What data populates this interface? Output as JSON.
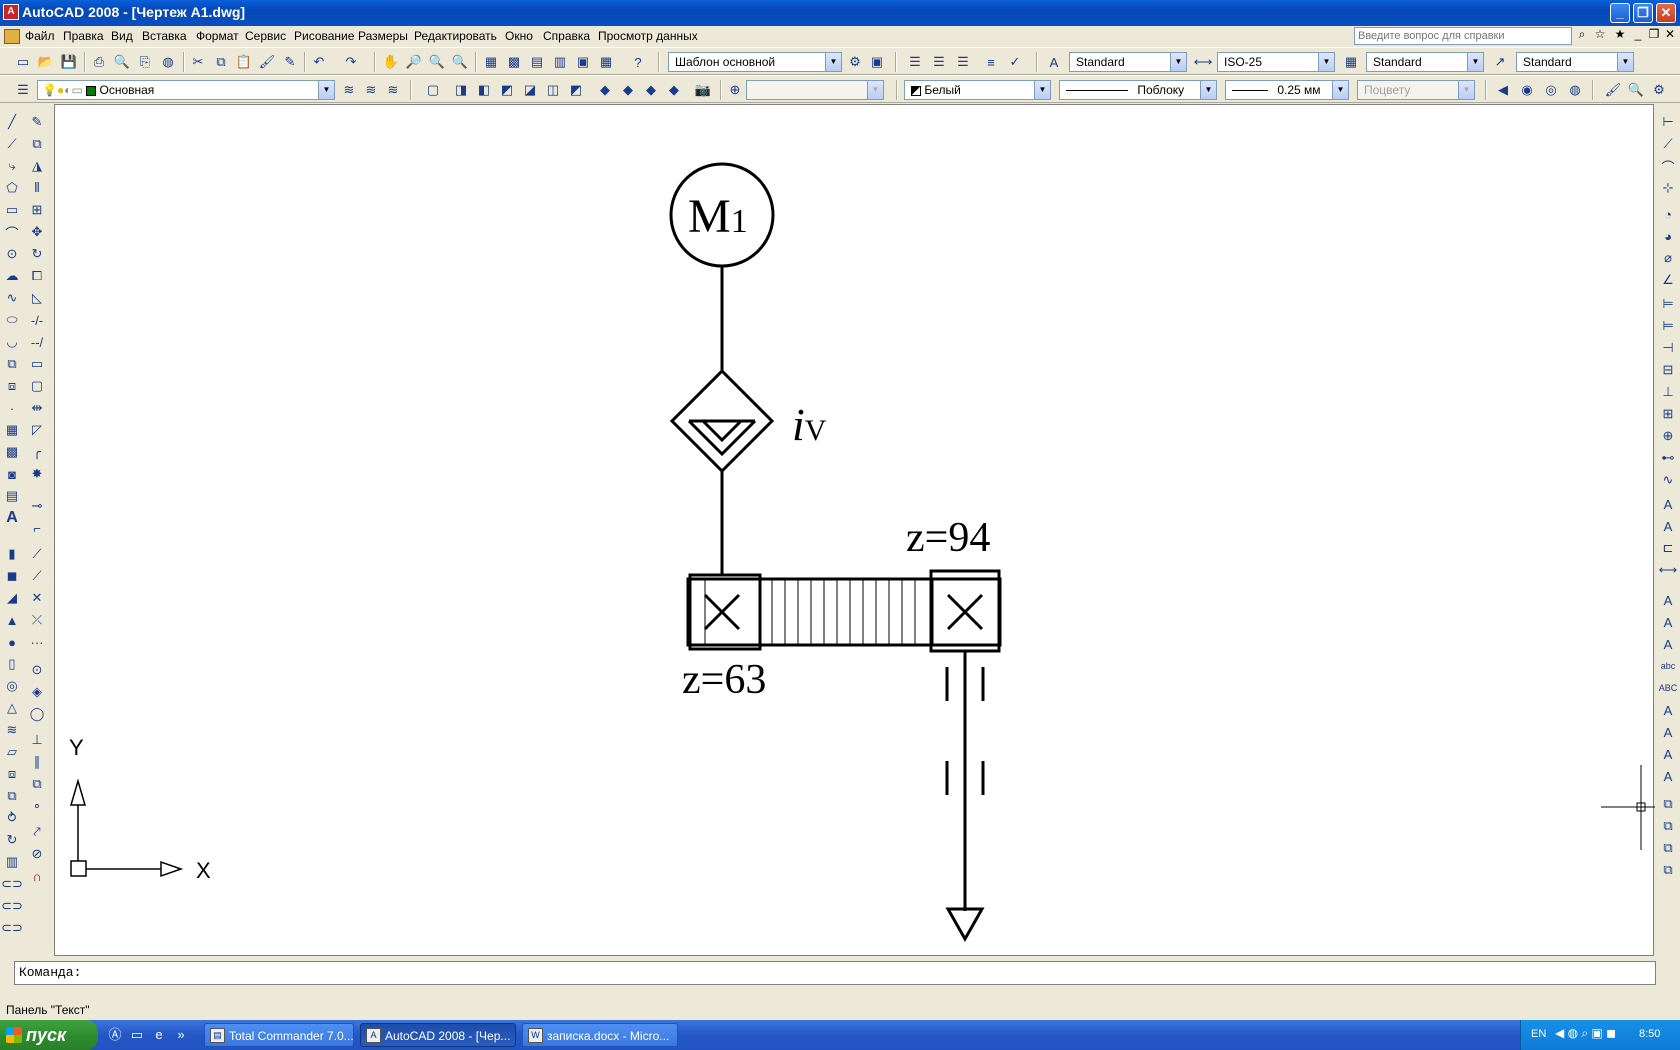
{
  "window": {
    "title": "AutoCAD 2008 - [Чертеж A1.dwg]",
    "app_icon": "A",
    "minimize": "_",
    "restore": "❐",
    "close": "✕"
  },
  "menu": {
    "items": [
      "Файл",
      "Правка",
      "Вид",
      "Вставка",
      "Формат",
      "Сервис",
      "Рисование",
      "Размеры",
      "Редактировать",
      "Окно",
      "Справка",
      "Просмотр данных"
    ],
    "help_placeholder": "Введите вопрос для справки"
  },
  "toolbar1": {
    "workspace": "Шаблон основной",
    "text_style": "Standard",
    "dim_style": "ISO-25",
    "table_style": "Standard",
    "mleader_style": "Standard"
  },
  "toolbar2": {
    "layer": "Основная",
    "color": "Белый",
    "linetype": "Поблоку",
    "lineweight": "0.25 мм",
    "plotstyle": "Поцвету"
  },
  "drawing": {
    "motor_label": "M",
    "motor_index": "1",
    "variator_label": "i",
    "variator_sub": "V",
    "gear_top_label": "z=94",
    "gear_bottom_label": "z=63",
    "ucs_x": "X",
    "ucs_y": "Y"
  },
  "command": {
    "prompt": "Команда:"
  },
  "status": {
    "panel_text": "Панель \"Текст\""
  },
  "taskbar": {
    "start": "пуск",
    "tasks": [
      "Total Commander 7.0...",
      "AutoCAD 2008 - [Чер...",
      "записка.docx - Micro..."
    ],
    "lang": "EN",
    "clock": "8:50"
  }
}
